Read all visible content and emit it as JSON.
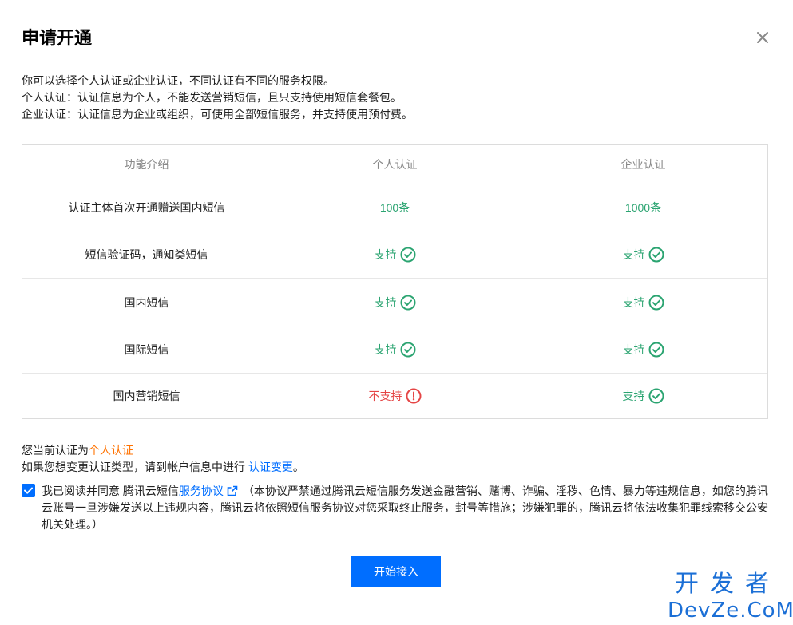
{
  "dialog": {
    "title": "申请开通",
    "intro": [
      "你可以选择个人认证或企业认证，不同认证有不同的服务权限。",
      "个人认证：认证信息为个人，不能发送营销短信，且只支持使用短信套餐包。",
      "企业认证：认证信息为企业或组织，可使用全部短信服务，并支持使用预付费。"
    ]
  },
  "table": {
    "headers": [
      "功能介绍",
      "个人认证",
      "企业认证"
    ],
    "rows": [
      {
        "feature": "认证主体首次开通赠送国内短信",
        "personal": "100条",
        "enterprise": "1000条"
      },
      {
        "feature": "短信验证码，通知类短信",
        "personal": "支持",
        "enterprise": "支持"
      },
      {
        "feature": "国内短信",
        "personal": "支持",
        "enterprise": "支持"
      },
      {
        "feature": "国际短信",
        "personal": "支持",
        "enterprise": "支持"
      },
      {
        "feature": "国内营销短信",
        "personal": "不支持",
        "enterprise": "支持"
      }
    ]
  },
  "current": {
    "prefix": "您当前认证为",
    "value": "个人认证",
    "change_prefix": "如果您想变更认证类型，请到帐户信息中进行 ",
    "change_link": "认证变更",
    "change_suffix": "。"
  },
  "agreement": {
    "checked": true,
    "prefix": "我已阅读并同意 腾讯云短信",
    "link": "服务协议",
    "note": "（本协议严禁通过腾讯云短信服务发送金融营销、赌博、诈骗、淫秽、色情、暴力等违规信息，如您的腾讯云账号一旦涉嫌发送以上违规内容，腾讯云将依照短信服务协议对您采取终止服务，封号等措施；涉嫌犯罪的，腾讯云将依法收集犯罪线索移交公安机关处理。）"
  },
  "button": {
    "label": "开始接入"
  },
  "watermark": {
    "line1": "开发者",
    "line2": "DevZe.CoM"
  },
  "colors": {
    "primary": "#006eff",
    "success": "#2ba471",
    "error": "#e54545",
    "highlight": "#ff7200"
  }
}
